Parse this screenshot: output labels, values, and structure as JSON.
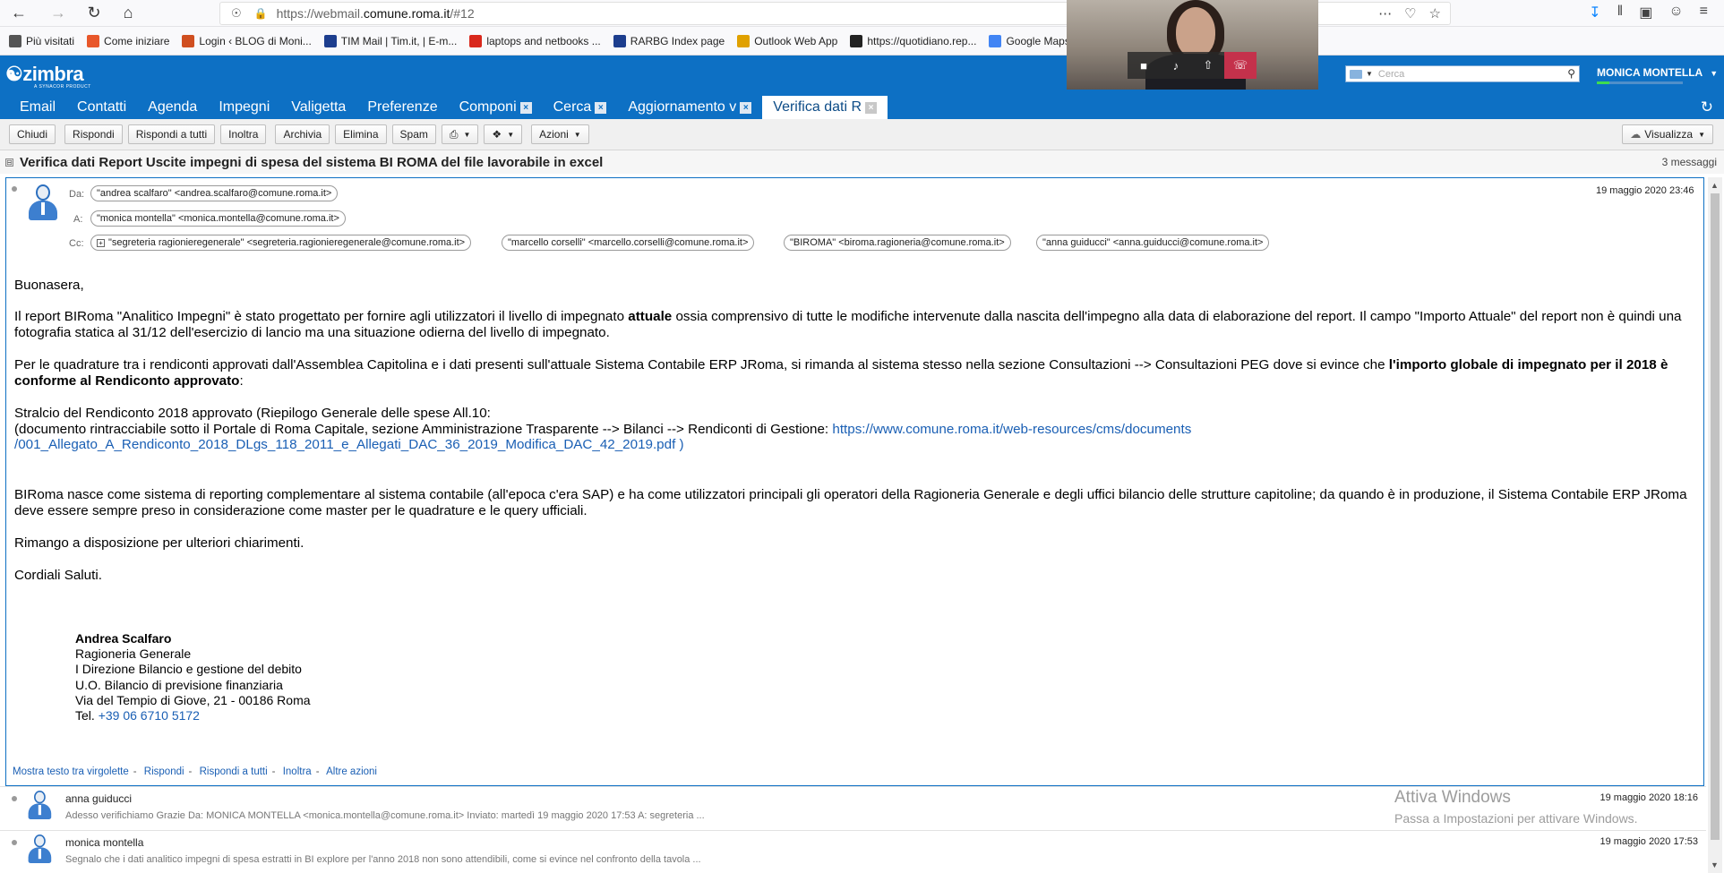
{
  "browser": {
    "url_prefix": "https://webmail.",
    "url_domain": "comune.roma.it",
    "url_suffix": "/#12"
  },
  "bookmarks": [
    {
      "label": "Più visitati",
      "icon": "gear-icon",
      "color": "#555555"
    },
    {
      "label": "Come iniziare",
      "icon": "firefox-icon",
      "color": "#e8572a"
    },
    {
      "label": "Login ‹ BLOG di Moni...",
      "icon": "blog-icon",
      "color": "#d04f20"
    },
    {
      "label": "TIM Mail | Tim.it, | E-m...",
      "icon": "mail-icon",
      "color": "#1d3e8e"
    },
    {
      "label": "laptops and netbooks ...",
      "icon": "l-icon",
      "color": "#d9281c"
    },
    {
      "label": "RARBG Index page",
      "icon": "r-icon",
      "color": "#1d3e8e"
    },
    {
      "label": "Outlook Web App",
      "icon": "outlook-icon",
      "color": "#e0a100"
    },
    {
      "label": "https://quotidiano.rep...",
      "icon": "r-icon",
      "color": "#222222"
    },
    {
      "label": "Google Maps",
      "icon": "google-icon",
      "color": "#4285f4"
    }
  ],
  "zimbra": {
    "logo": "zimbra",
    "logo_sub": "A SYNACOR PRODUCT",
    "search_placeholder": "Cerca",
    "user": "MONICA MONTELLA",
    "tabs": [
      {
        "label": "Email",
        "closable": false
      },
      {
        "label": "Contatti",
        "closable": false
      },
      {
        "label": "Agenda",
        "closable": false
      },
      {
        "label": "Impegni",
        "closable": false
      },
      {
        "label": "Valigetta",
        "closable": false
      },
      {
        "label": "Preferenze",
        "closable": false
      },
      {
        "label": "Componi",
        "closable": true
      },
      {
        "label": "Cerca",
        "closable": true
      },
      {
        "label": "Aggiornamento v",
        "closable": true
      },
      {
        "label": "Verifica dati R",
        "closable": true
      }
    ],
    "toolbar": {
      "chiudi": "Chiudi",
      "rispondi": "Rispondi",
      "rispondi_tutti": "Rispondi a tutti",
      "inoltra": "Inoltra",
      "archivia": "Archivia",
      "elimina": "Elimina",
      "spam": "Spam",
      "azioni": "Azioni",
      "visualizza": "Visualizza"
    }
  },
  "conversation": {
    "subject": "Verifica dati Report Uscite impegni di spesa del sistema BI ROMA del file lavorabile in excel",
    "count": "3 messaggi"
  },
  "message": {
    "from_label": "Da:",
    "to_label": "A:",
    "cc_label": "Cc:",
    "from": "\"andrea scalfaro\" <andrea.scalfaro@comune.roma.it>",
    "to": "\"monica montella\" <monica.montella@comune.roma.it>",
    "cc": [
      "\"segreteria ragionieregenerale\" <segreteria.ragionieregenerale@comune.roma.it>",
      "\"marcello corselli\" <marcello.corselli@comune.roma.it>",
      "\"BIROMA\" <biroma.ragioneria@comune.roma.it>",
      "\"anna guiducci\" <anna.guiducci@comune.roma.it>"
    ],
    "date": "19 maggio 2020 23:46",
    "greeting": "Buonasera,",
    "p1_a": "Il report BIRoma \"Analitico Impegni\" è stato progettato per fornire agli utilizzatori il livello di impegnato ",
    "p1_bold": "attuale",
    "p1_b": " ossia comprensivo di tutte le modifiche intervenute dalla nascita dell'impegno alla data di elaborazione del report. Il campo \"Importo Attuale\" del report non è quindi una fotografia statica al 31/12 dell'esercizio di lancio ma una situazione odierna del livello di impegnato.",
    "p2_a": "Per le quadrature tra i rendiconti approvati dall'Assemblea Capitolina e i dati presenti sull'attuale Sistema Contabile ERP JRoma, si rimanda al sistema stesso nella sezione Consultazioni --> Consultazioni PEG dove si evince che ",
    "p2_bold": "l'importo globale di impegnato per il 2018 è conforme al Rendiconto approvato",
    "p2_b": ":",
    "p3_line1": "Stralcio del Rendiconto 2018 approvato (Riepilogo Generale delle spese All.10:",
    "p3_line2_a": "(documento rintracciabile sotto il Portale di Roma Capitale, sezione Amministrazione Trasparente --> Bilanci --> Rendiconti di Gestione: ",
    "p3_link1": "https://www.comune.roma.it/web-resources/cms/documents",
    "p3_link2": "/001_Allegato_A_Rendiconto_2018_DLgs_118_2011_e_Allegati_DAC_36_2019_Modifica_DAC_42_2019.pdf )",
    "p4": "BIRoma nasce come sistema di reporting complementare al sistema contabile (all'epoca c'era SAP) e ha come utilizzatori principali gli operatori della Ragioneria Generale e degli uffici bilancio delle strutture capitoline; da quando è in produzione, il Sistema Contabile ERP JRoma deve essere sempre preso in considerazione come master per le quadrature e le query ufficiali.",
    "p5": "Rimango a disposizione per ulteriori chiarimenti.",
    "p6": "Cordiali Saluti.",
    "signature": {
      "name": "Andrea Scalfaro",
      "line1": "Ragioneria Generale",
      "line2": "I Direzione Bilancio e gestione del debito",
      "line3": "U.O. Bilancio di previsione finanziaria",
      "line4": "Via del Tempio di Giove, 21 - 00186 Roma",
      "tel_label": "Tel. ",
      "tel": "+39 06 6710 5172"
    },
    "actions": {
      "quoted": "Mostra testo tra virgolette",
      "reply": "Rispondi",
      "reply_all": "Rispondi a tutti",
      "forward": "Inoltra",
      "more": "Altre azioni"
    }
  },
  "collapsed_messages": [
    {
      "from": "anna guiducci",
      "date": "19 maggio 2020 18:16",
      "snippet": "Adesso verifichiamo Grazie Da: MONICA MONTELLA <monica.montella@comune.roma.it> Inviato: martedì 19 maggio 2020 17:53 A: segreteria ..."
    },
    {
      "from": "monica montella",
      "date": "19 maggio 2020 17:53",
      "snippet": "Segnalo che i dati analitico impegni di spesa estratti in BI explore per l'anno 2018 non sono attendibili, come si evince nel confronto della tavola ..."
    }
  ],
  "watermark": {
    "title": "Attiva Windows",
    "subtitle": "Passa a Impostazioni per attivare Windows."
  }
}
